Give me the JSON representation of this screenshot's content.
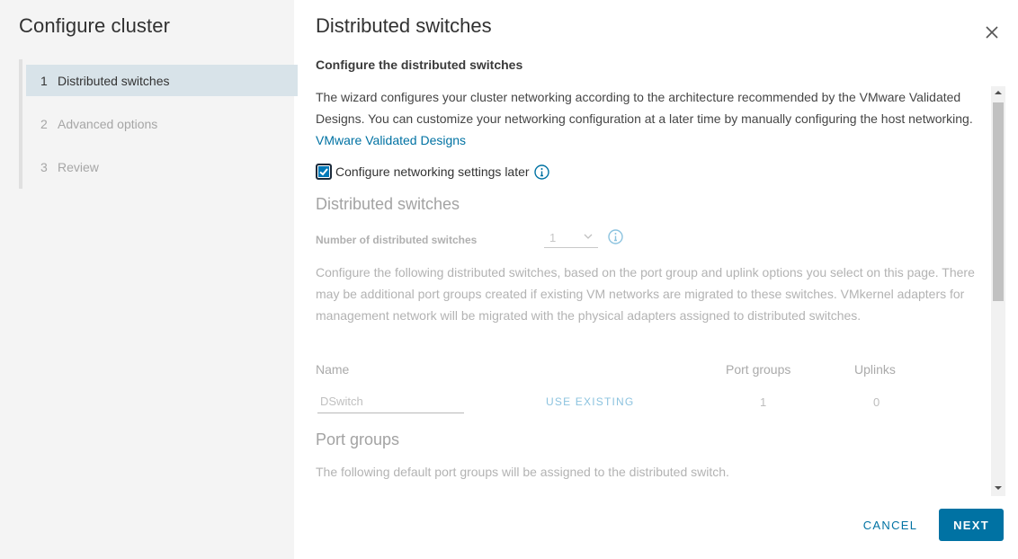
{
  "wizard": {
    "title": "Configure cluster",
    "steps": [
      {
        "num": "1",
        "label": "Distributed switches",
        "state": "active"
      },
      {
        "num": "2",
        "label": "Advanced options",
        "state": "inactive"
      },
      {
        "num": "3",
        "label": "Review",
        "state": "inactive"
      }
    ]
  },
  "page": {
    "title": "Distributed switches",
    "subtitle": "Configure the distributed switches",
    "intro_text": "The wizard configures your cluster networking according to the architecture recommended by the VMware Validated Designs. You can customize your networking configuration at a later time by manually configuring the host networking.",
    "intro_link": "VMware Validated Designs",
    "configure_later": {
      "label": "Configure networking settings later",
      "checked": true
    },
    "switches_section": {
      "title": "Distributed switches",
      "count_label": "Number of distributed switches",
      "count_value": "1",
      "description": "Configure the following distributed switches, based on the port group and uplink options you select on this page. There may be additional port groups created if existing VM networks are migrated to these switches. VMkernel adapters for management network will be migrated with the physical adapters assigned to distributed switches.",
      "columns": {
        "name": "Name",
        "port_groups": "Port groups",
        "uplinks": "Uplinks"
      },
      "rows": [
        {
          "name": "DSwitch",
          "action": "USE EXISTING",
          "port_groups": "1",
          "uplinks": "0"
        }
      ]
    },
    "port_groups_section": {
      "title": "Port groups",
      "description": "The following default port groups will be assigned to the distributed switch."
    }
  },
  "footer": {
    "cancel": "CANCEL",
    "next": "NEXT"
  },
  "colors": {
    "accent": "#0072a3",
    "active_step_bg": "#d8e3e9",
    "panel_bg": "#f4f4f4"
  }
}
